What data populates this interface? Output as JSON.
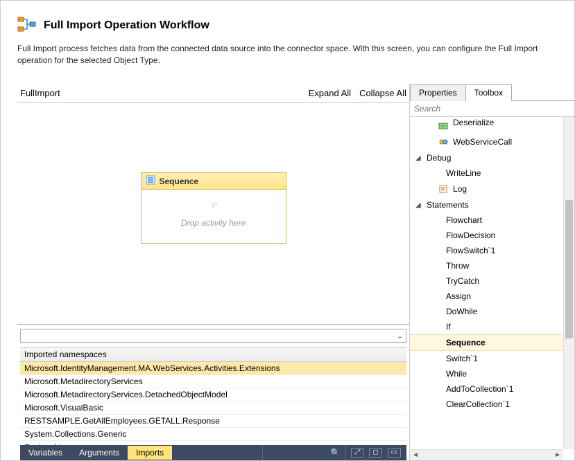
{
  "header": {
    "title": "Full Import Operation Workflow",
    "description": "Full Import process fetches data from the connected data source into the connector space. With this screen, you can configure the Full Import operation for the selected Object Type."
  },
  "designer": {
    "breadcrumb": "FullImport",
    "expand_all": "Expand All",
    "collapse_all": "Collapse All",
    "sequence_label": "Sequence",
    "drop_hint": "Drop activity here"
  },
  "namespaces": {
    "header": "Imported namespaces",
    "items": [
      "Microsoft.IdentityManagement.MA.WebServices.Activities.Extensions",
      "Microsoft.MetadirectoryServices",
      "Microsoft.MetadirectoryServices.DetachedObjectModel",
      "Microsoft.VisualBasic",
      "RESTSAMPLE.GetAllEmployees.GETALL.Response",
      "System.Collections.Generic",
      "System.Linq"
    ],
    "selected_index": 0
  },
  "footer": {
    "variables": "Variables",
    "arguments": "Arguments",
    "imports": "Imports"
  },
  "right": {
    "tab_properties": "Properties",
    "tab_toolbox": "Toolbox",
    "search_placeholder": "Search",
    "items": [
      {
        "label": "Deserialize",
        "level": 1,
        "icon": "deserialize-icon",
        "partial": true
      },
      {
        "label": "WebServiceCall",
        "level": 1,
        "icon": "webservice-icon"
      },
      {
        "label": "Debug",
        "level": 0,
        "category": true
      },
      {
        "label": "WriteLine",
        "level": 2
      },
      {
        "label": "Log",
        "level": 1,
        "icon": "log-icon"
      },
      {
        "label": "Statements",
        "level": 0,
        "category": true
      },
      {
        "label": "Flowchart",
        "level": 2
      },
      {
        "label": "FlowDecision",
        "level": 2
      },
      {
        "label": "FlowSwitch`1",
        "level": 2
      },
      {
        "label": "Throw",
        "level": 2
      },
      {
        "label": "TryCatch",
        "level": 2
      },
      {
        "label": "Assign",
        "level": 2
      },
      {
        "label": "DoWhile",
        "level": 2
      },
      {
        "label": "If",
        "level": 2
      },
      {
        "label": "Sequence",
        "level": 2,
        "selected": true
      },
      {
        "label": "Switch`1",
        "level": 2
      },
      {
        "label": "While",
        "level": 2
      },
      {
        "label": "AddToCollection`1",
        "level": 2
      },
      {
        "label": "ClearCollection`1",
        "level": 2
      }
    ]
  }
}
